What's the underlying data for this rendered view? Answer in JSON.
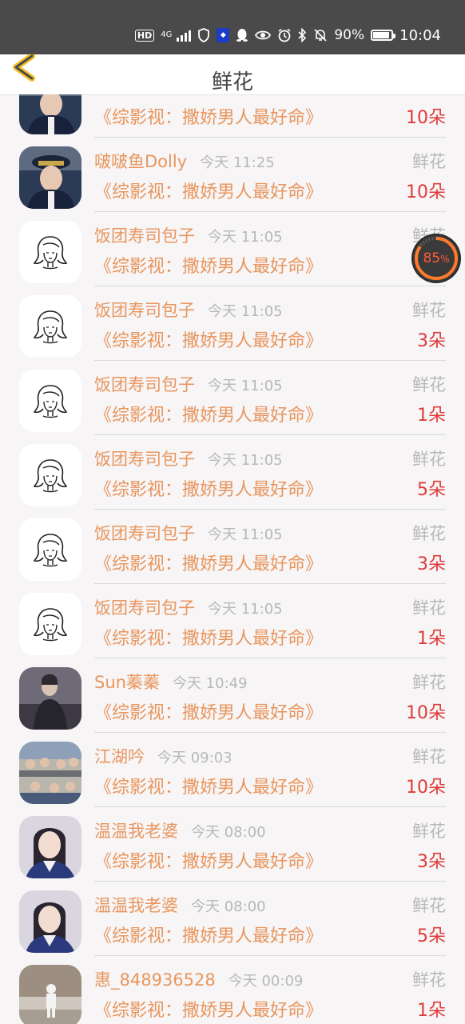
{
  "status_bar": {
    "network": "4G",
    "battery": "90%",
    "battery_level": 0.9,
    "time": "10:04"
  },
  "header": {
    "title": "鲜花"
  },
  "floating_widget": {
    "value": "85",
    "unit": "%"
  },
  "list": [
    {
      "name": "",
      "time": "",
      "gift": "",
      "book": "《综影视：撒娇男人最好命》",
      "count": "10朵",
      "avatar": "police-photo"
    },
    {
      "name": "啵啵鱼Dolly",
      "time": "今天 11:25",
      "gift": "鲜花",
      "book": "《综影视：撒娇男人最好命》",
      "count": "10朵",
      "avatar": "police-photo"
    },
    {
      "name": "饭团寿司包子",
      "time": "今天 11:05",
      "gift": "鲜花",
      "book": "《综影视：撒娇男人最好命》",
      "count": "",
      "avatar": "girl-sketch"
    },
    {
      "name": "饭团寿司包子",
      "time": "今天 11:05",
      "gift": "鲜花",
      "book": "《综影视：撒娇男人最好命》",
      "count": "3朵",
      "avatar": "girl-sketch"
    },
    {
      "name": "饭团寿司包子",
      "time": "今天 11:05",
      "gift": "鲜花",
      "book": "《综影视：撒娇男人最好命》",
      "count": "1朵",
      "avatar": "girl-sketch"
    },
    {
      "name": "饭团寿司包子",
      "time": "今天 11:05",
      "gift": "鲜花",
      "book": "《综影视：撒娇男人最好命》",
      "count": "5朵",
      "avatar": "girl-sketch"
    },
    {
      "name": "饭团寿司包子",
      "time": "今天 11:05",
      "gift": "鲜花",
      "book": "《综影视：撒娇男人最好命》",
      "count": "3朵",
      "avatar": "girl-sketch"
    },
    {
      "name": "饭团寿司包子",
      "time": "今天 11:05",
      "gift": "鲜花",
      "book": "《综影视：撒娇男人最好命》",
      "count": "1朵",
      "avatar": "girl-sketch"
    },
    {
      "name": "Sun蓁蓁",
      "time": "今天 10:49",
      "gift": "鲜花",
      "book": "《综影视：撒娇男人最好命》",
      "count": "10朵",
      "avatar": "dark-photo"
    },
    {
      "name": "江湖吟",
      "time": "今天 09:03",
      "gift": "鲜花",
      "book": "《综影视：撒娇男人最好命》",
      "count": "10朵",
      "avatar": "group-photo"
    },
    {
      "name": "温温我老婆",
      "time": "今天 08:00",
      "gift": "鲜花",
      "book": "《综影视：撒娇男人最好命》",
      "count": "3朵",
      "avatar": "costume-photo"
    },
    {
      "name": "温温我老婆",
      "time": "今天 08:00",
      "gift": "鲜花",
      "book": "《综影视：撒娇男人最好命》",
      "count": "5朵",
      "avatar": "costume-photo"
    },
    {
      "name": "惠_848936528",
      "time": "今天 00:09",
      "gift": "鲜花",
      "book": "《综影视：撒娇男人最好命》",
      "count": "1朵",
      "avatar": "child-photo"
    }
  ],
  "colors": {
    "accent": "#e8965e",
    "count": "#e03a3a",
    "muted": "#b8b8b8",
    "status_bar": "#4a4a4a"
  }
}
